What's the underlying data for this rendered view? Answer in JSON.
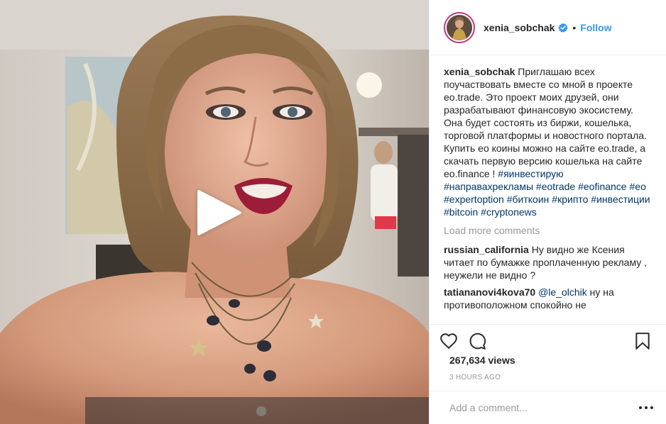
{
  "header": {
    "username": "xenia_sobchak",
    "separator": "•",
    "follow_label": "Follow"
  },
  "caption": {
    "username": "xenia_sobchak",
    "text": "Приглашаю всех поучаствовать вместе со мной в проекте eo.trade. Это проект моих друзей, они разрабатывают финансовую экосистему. Она будет состоять из биржи, кошелька, торговой платформы и новостного портала. Купить ео коины можно на сайте eo.trade, а скачать первую версию кошелька на сайте eo.finance !",
    "text_p1": "Приглашаю всех поучаствовать вместе со мной в проекте eo.trade. Это проект моих друзей, они разрабатывают финансовую экосистему. Она будет состоять из биржи, кошелька, торговой платформы и новостного портала.",
    "text_p2": "Купить ео коины можно на сайте eo.trade, а скачать первую версию кошелька на сайте eo.finance !",
    "hashtags": [
      "#яинвестирую",
      "#направахрекламы",
      "#eotrade",
      "#eofinance",
      "#ео",
      "#expertoption",
      "#биткоин",
      "#крипто",
      "#инвестиции",
      "#bitcoin",
      "#cryptonews"
    ]
  },
  "load_more_label": "Load more comments",
  "comments": [
    {
      "username": "russian_california",
      "mention": "",
      "text": "Ну видно же Ксения читает по бумажке проплаченную рекламу , неужели не видно ?"
    },
    {
      "username": "tatiananovi4kova70",
      "mention": "@le_olchik",
      "text": "ну на противоположном спокойно не"
    }
  ],
  "views": "267,634 views",
  "timestamp": "3 HOURS AGO",
  "add_comment_placeholder": "Add a comment...",
  "icons": {
    "verified": "verified-badge-icon",
    "like": "heart-icon",
    "comment": "comment-bubble-icon",
    "save": "bookmark-icon",
    "play": "play-icon",
    "more": "more-options-icon"
  },
  "colors": {
    "accent": "#3897f0",
    "hashtag": "#003569",
    "muted": "#999999",
    "text": "#262626"
  }
}
